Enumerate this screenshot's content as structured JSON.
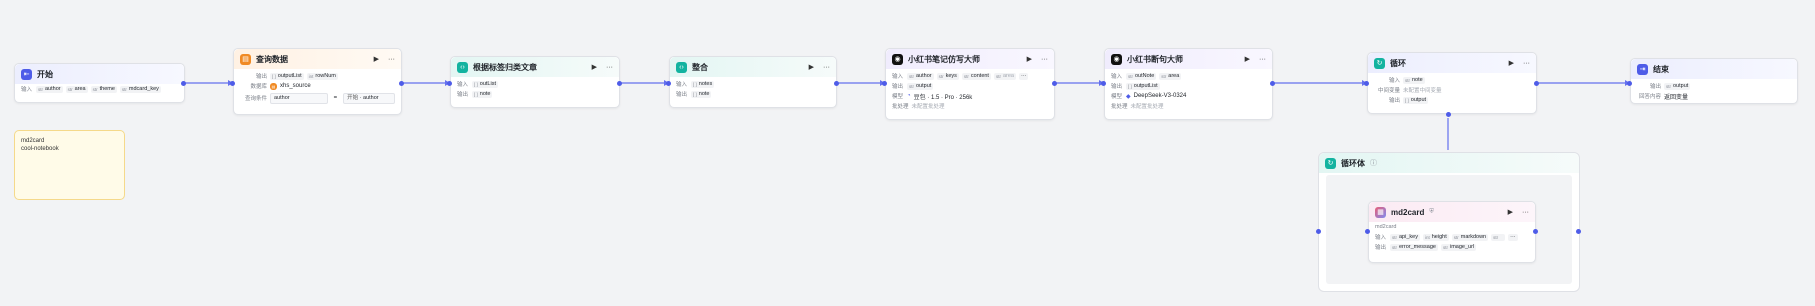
{
  "nodes": {
    "start": {
      "title": "开始",
      "input_label": "输入",
      "inputs": [
        {
          "type": "str",
          "name": "author"
        },
        {
          "type": "str",
          "name": "area"
        },
        {
          "type": "str",
          "name": "theme"
        },
        {
          "type": "str",
          "name": "mdcard_key"
        }
      ]
    },
    "query": {
      "title": "查询数据",
      "output_label": "输出",
      "outputs": [
        {
          "type": "[ ]",
          "name": "outputList"
        },
        {
          "type": "int",
          "name": "rowNum"
        }
      ],
      "db_label": "数据库",
      "db_name": "xhs_source",
      "cond_label": "查询条件",
      "cond_field": "author",
      "cond_op": "=",
      "cond_value_type": "开始",
      "cond_value": "author"
    },
    "classify": {
      "title": "根据标签归类文章",
      "input_label": "输入",
      "input": {
        "type": "[ ]",
        "name": "outList"
      },
      "output_label": "输出",
      "output": {
        "type": "[ ]",
        "name": "note"
      }
    },
    "merge": {
      "title": "整合",
      "input_label": "输入",
      "input": {
        "type": "[ ]",
        "name": "notes"
      },
      "output_label": "输出",
      "output": {
        "type": "[ ]",
        "name": "note"
      }
    },
    "xhs_writer": {
      "title": "小红书笔记仿写大师",
      "input_label": "输入",
      "inputs": [
        {
          "type": "str",
          "name": "author"
        },
        {
          "type": "str",
          "name": "keys"
        },
        {
          "type": "str",
          "name": "content"
        },
        {
          "type": "str",
          "name": "area"
        }
      ],
      "more": "···",
      "output_label": "输出",
      "output": {
        "type": "str",
        "name": "output"
      },
      "model_label": "模型",
      "model": "豆包 · 1.5 · Pro · 256k",
      "batch_label": "批处理",
      "batch": "未配置批处理"
    },
    "xhs_breaker": {
      "title": "小红书断句大师",
      "input_label": "输入",
      "inputs": [
        {
          "type": "str",
          "name": "outNote"
        },
        {
          "type": "str",
          "name": "area"
        }
      ],
      "output_label": "输出",
      "output": {
        "type": "[ ]",
        "name": "outputList"
      },
      "model_label": "模型",
      "model": "DeepSeek-V3-0324",
      "batch_label": "批处理",
      "batch": "未配置批处理"
    },
    "loop": {
      "title": "循环",
      "input_label": "输入",
      "input": {
        "type": "str",
        "name": "note"
      },
      "mid_label": "中间变量",
      "mid_value": "未配置中间变量",
      "output_label": "输出",
      "output": {
        "type": "[ ]",
        "name": "output"
      }
    },
    "end": {
      "title": "结束",
      "output_label": "输出",
      "output": {
        "type": "str",
        "name": "output"
      },
      "answer_label": "回答内容",
      "answer": "返回变量"
    },
    "loop_body": {
      "title": "循环体",
      "info": "ⓘ"
    },
    "md2card": {
      "title": "md2card",
      "badge": "⛨",
      "subtitle": "md2card",
      "input_label": "输入",
      "inputs": [
        {
          "type": "str",
          "name": "api_key"
        },
        {
          "type": "int",
          "name": "height"
        },
        {
          "type": "str",
          "name": "markdown"
        },
        {
          "type": "str",
          "name": ""
        }
      ],
      "more": "···",
      "output_label": "输出",
      "outputs": [
        {
          "type": "str",
          "name": "error_message"
        },
        {
          "type": "str",
          "name": "image_url"
        }
      ]
    }
  },
  "note": {
    "lines": [
      "md2card",
      "cool-notebook"
    ]
  },
  "controls": {
    "run": "▶",
    "more": "···"
  },
  "colors": {
    "edge": "#4e5ce8",
    "brand": "#4e5ce8"
  }
}
